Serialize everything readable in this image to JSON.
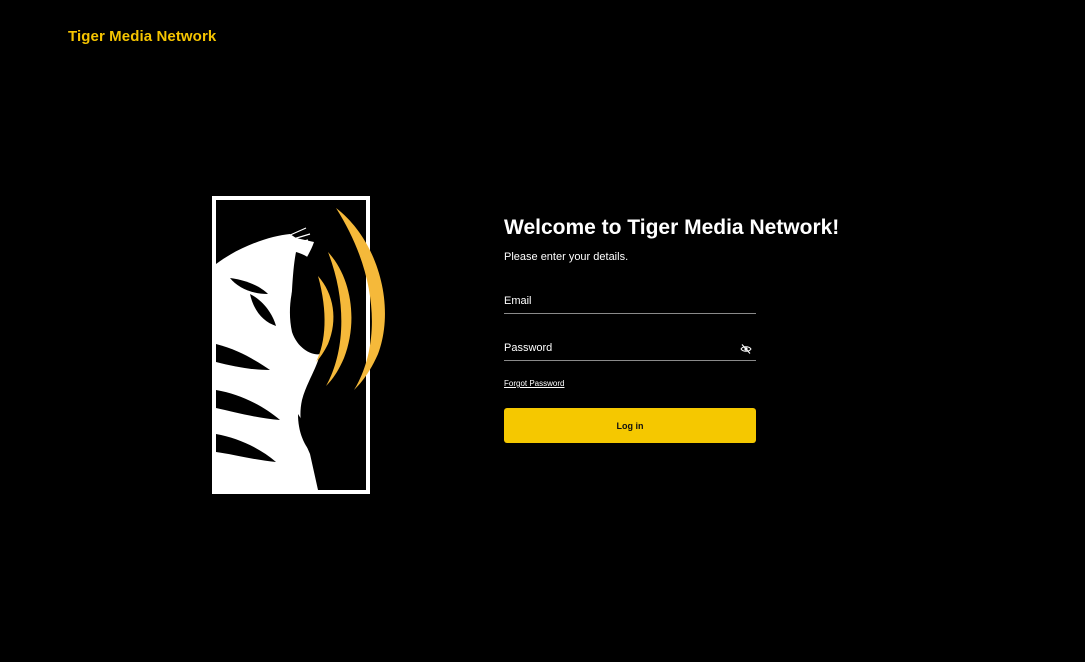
{
  "header": {
    "brand": "Tiger Media Network"
  },
  "colors": {
    "background": "#000000",
    "accent": "#f5c800",
    "brand_text": "#f5c400",
    "logo_wave": "#f5b93a"
  },
  "logo": {
    "icon": "tiger-roar-logo-icon"
  },
  "login": {
    "title": "Welcome to Tiger Media Network!",
    "subtitle": "Please enter your details.",
    "email_placeholder": "Email",
    "email_value": "",
    "password_placeholder": "Password",
    "password_value": "",
    "password_toggle_icon": "eye-off-icon",
    "forgot_label": "Forgot Password",
    "submit_label": "Log in"
  }
}
